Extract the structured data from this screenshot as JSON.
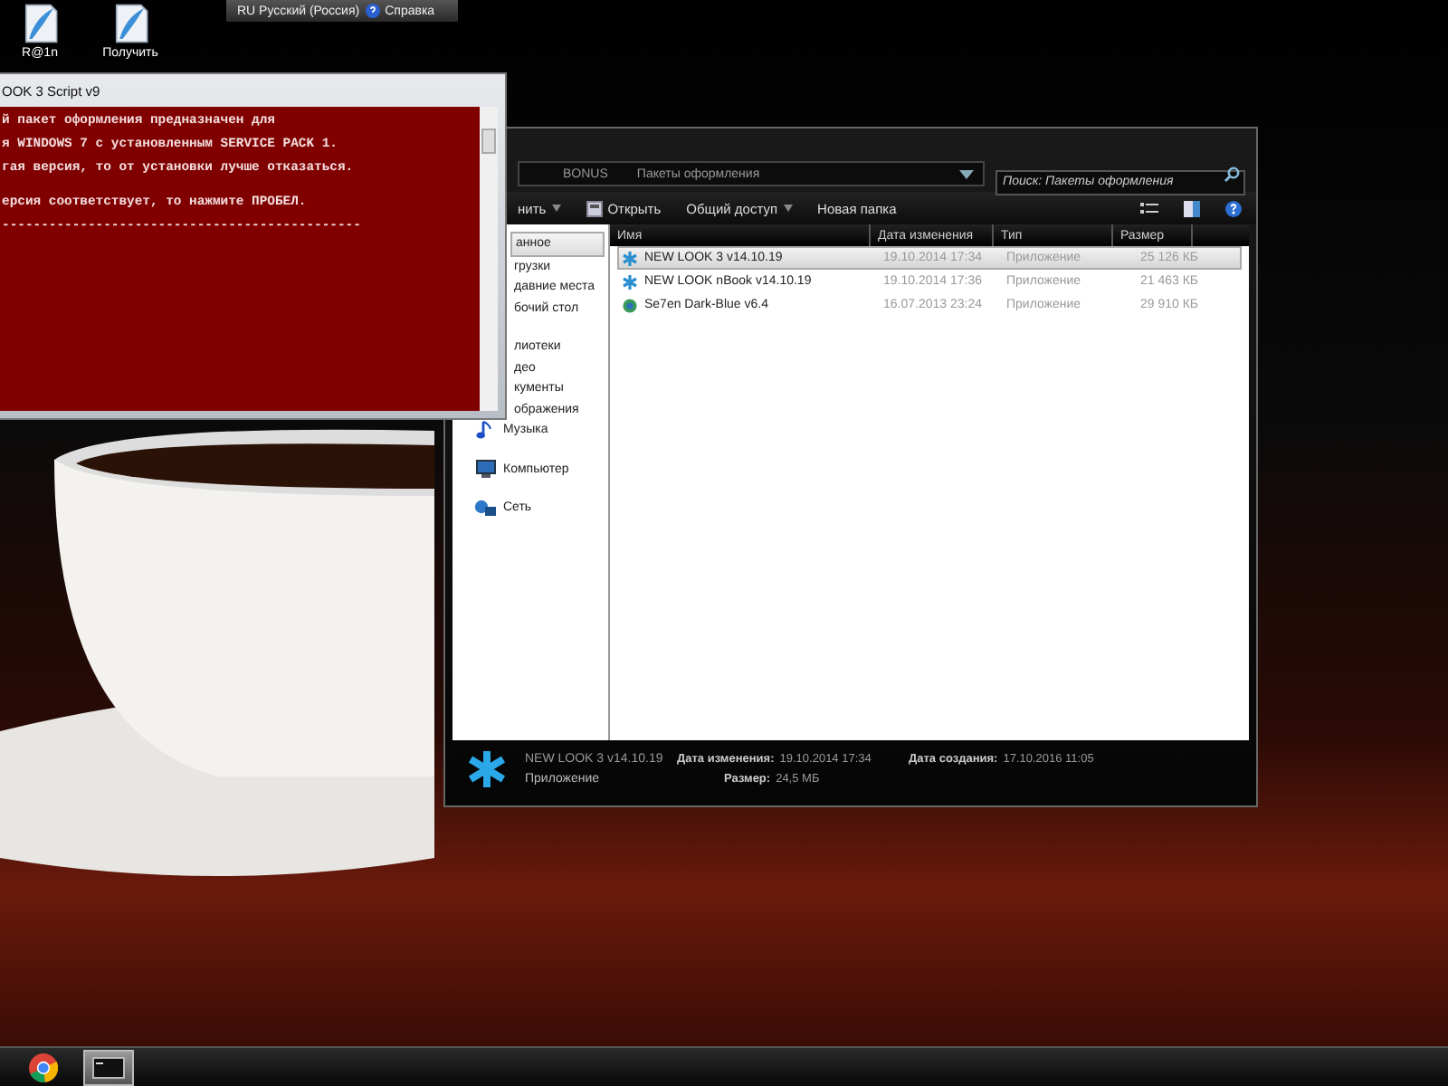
{
  "language_bar": {
    "language": "RU Русский (Россия)",
    "help": "Справка"
  },
  "desktop_icons": [
    {
      "label": "R@1n"
    },
    {
      "label": "Получить"
    }
  ],
  "console_window": {
    "title": "OOK 3 Script v9",
    "lines": [
      "й пакет оформления предназначен для",
      "я WINDOWS 7 с установленным SERVICE PACK 1.",
      "гая версия, то от установки лучше отказаться.",
      "ерсия соответствует, то нажмите ПРОБЕЛ.",
      "----------------------------------------------"
    ]
  },
  "explorer": {
    "breadcrumb": [
      "BONUS",
      "Пакеты оформления"
    ],
    "search": {
      "placeholder": "Поиск: Пакеты оформления"
    },
    "toolbar": [
      {
        "label": "нить",
        "kind": "menu"
      },
      {
        "label": "Открыть",
        "kind": "file"
      },
      {
        "label": "Общий доступ",
        "kind": "menu"
      },
      {
        "label": "Новая папка",
        "kind": "plain"
      }
    ],
    "nav_groups": [
      {
        "items": [
          {
            "label": "анное",
            "selected": true,
            "kind": "none"
          },
          {
            "label": "грузки",
            "selected": false,
            "kind": "none"
          },
          {
            "label": "давние места",
            "selected": false,
            "kind": "none"
          },
          {
            "label": "бочий стол",
            "selected": false,
            "kind": "none"
          }
        ]
      },
      {
        "items": [
          {
            "label": "лиотеки",
            "selected": false,
            "kind": "none"
          },
          {
            "label": "део",
            "selected": false,
            "kind": "none"
          },
          {
            "label": "кументы",
            "selected": false,
            "kind": "none"
          },
          {
            "label": "ображения",
            "selected": false,
            "kind": "none"
          },
          {
            "label": "Музыка",
            "selected": false,
            "kind": "music"
          }
        ]
      },
      {
        "items": [
          {
            "label": "Компьютер",
            "selected": false,
            "kind": "computer"
          }
        ]
      },
      {
        "items": [
          {
            "label": "Сеть",
            "selected": false,
            "kind": "network"
          }
        ]
      }
    ],
    "columns": [
      "Имя",
      "Дата изменения",
      "Тип",
      "Размер"
    ],
    "rows": [
      {
        "name": "NEW LOOK 3 v14.10.19",
        "date": "19.10.2014 17:34",
        "type": "Приложение",
        "size": "25 126 КБ",
        "kind": "star",
        "selected": true
      },
      {
        "name": "NEW LOOK nBook v14.10.19",
        "date": "19.10.2014 17:36",
        "type": "Приложение",
        "size": "21 463 КБ",
        "kind": "star",
        "selected": false
      },
      {
        "name": "Se7en Dark-Blue v6.4",
        "date": "16.07.2013 23:24",
        "type": "Приложение",
        "size": "29 910 КБ",
        "kind": "globe",
        "selected": false
      }
    ],
    "details": {
      "name": "NEW LOOK 3 v14.10.19",
      "type": "Приложение",
      "modified_label": "Дата изменения:",
      "modified": "19.10.2014 17:34",
      "size_label": "Размер:",
      "size": "24,5 МБ",
      "created_label": "Дата создания:",
      "created": "17.10.2016 11:05"
    }
  },
  "taskbar": [
    {
      "kind": "browser",
      "selected": false
    },
    {
      "kind": "console",
      "selected": true
    }
  ]
}
